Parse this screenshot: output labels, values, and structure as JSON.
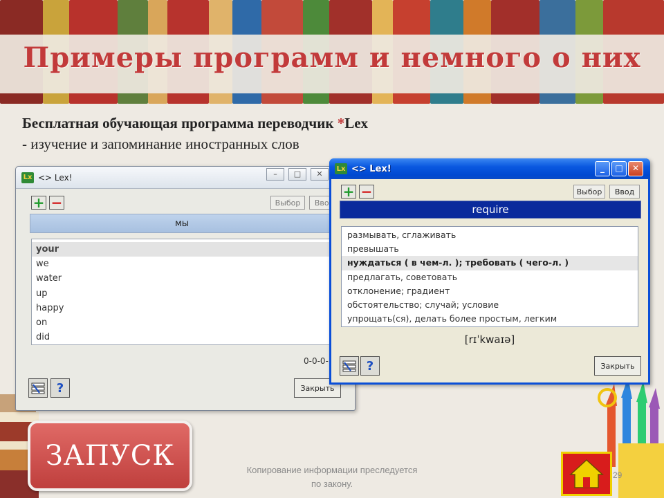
{
  "slide": {
    "title": "Примеры программ и немного о них",
    "subtitle_main": "Бесплатная обучающая программа переводчик ",
    "subtitle_star": "*",
    "subtitle_app": "Lex",
    "subtitle_desc": "- изучение и запоминание иностранных слов",
    "launch_label": "ЗАПУСК",
    "copyright_line1": "Копирование информации преследуется",
    "copyright_line2": "по закону.",
    "page_number": "29"
  },
  "window1": {
    "title": "<> Lex!",
    "select_label": "Выбор",
    "enter_label": "Ввод",
    "current_word": "мы",
    "words": [
      "your",
      "we",
      "water",
      "up",
      "happy",
      "on",
      "did"
    ],
    "selected_index": 0,
    "counter": "0-0-0-1",
    "close_label": "Закрыть"
  },
  "window2": {
    "title": "<> Lex!",
    "select_label": "Выбор",
    "enter_label": "Ввод",
    "current_word": "require",
    "translations": [
      "размывать, сглаживать",
      "превышать",
      "нуждаться ( в чем-л. ); требовать ( чего-л. )",
      "предлагать, советовать",
      "отклонение; градиент",
      "обстоятельство; случай; условие",
      "упрощать(ся), делать более простым, легким"
    ],
    "selected_index": 2,
    "transcription": "[rɪˈkwaɪə]",
    "close_label": "Закрыть"
  },
  "colors": {
    "title_red": "#c23a3a",
    "xp_blue": "#0a4fd8",
    "word_bar_dark": "#0a2a9c",
    "launch_button": "#cf4a47",
    "home_red": "#d81c1c",
    "home_yellow": "#f0d000"
  },
  "icons": [
    "plus-icon",
    "minus-icon",
    "settings-icon",
    "help-icon",
    "home-icon",
    "lex-app-icon"
  ]
}
